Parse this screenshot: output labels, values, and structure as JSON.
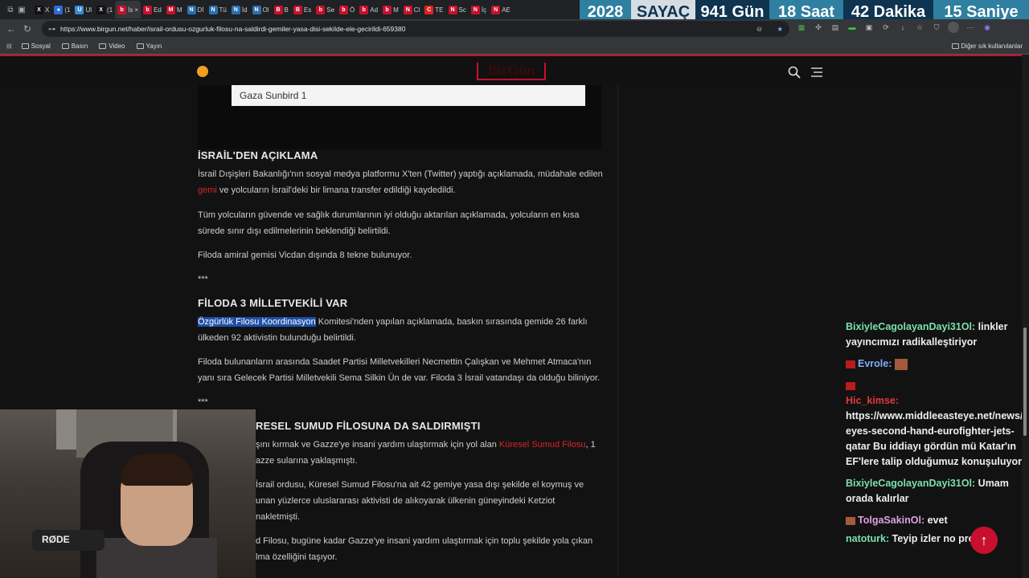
{
  "browser": {
    "tabs": [
      {
        "icon": "x-icon",
        "color": "#111111",
        "glyph": "X",
        "label": "X"
      },
      {
        "icon": "globe-icon",
        "color": "#2b6cd8",
        "glyph": "●",
        "label": "(1"
      },
      {
        "icon": "blue-icon",
        "color": "#3a8ad8",
        "glyph": "U",
        "label": "Ul"
      },
      {
        "icon": "x-icon",
        "color": "#111111",
        "glyph": "X",
        "label": "(1"
      },
      {
        "icon": "birgun-icon",
        "color": "#c8102e",
        "glyph": "b",
        "label": "İs",
        "active": true
      },
      {
        "icon": "birgun-icon",
        "color": "#c8102e",
        "glyph": "b",
        "label": "Ed"
      },
      {
        "icon": "mail-icon",
        "color": "#c8102e",
        "glyph": "M",
        "label": "M"
      },
      {
        "icon": "news-icon",
        "color": "#2a6fb0",
        "glyph": "N",
        "label": "Dİ"
      },
      {
        "icon": "news-icon",
        "color": "#2a6fb0",
        "glyph": "N",
        "label": "Tü"
      },
      {
        "icon": "news-icon",
        "color": "#2a6fb0",
        "glyph": "N",
        "label": "İd"
      },
      {
        "icon": "news-icon",
        "color": "#2a6fb0",
        "glyph": "N",
        "label": "Ol"
      },
      {
        "icon": "b-icon",
        "color": "#c8102e",
        "glyph": "B",
        "label": "B"
      },
      {
        "icon": "b-icon",
        "color": "#c8102e",
        "glyph": "B",
        "label": "Es"
      },
      {
        "icon": "birgun-icon",
        "color": "#c8102e",
        "glyph": "b",
        "label": "Se"
      },
      {
        "icon": "birgun-icon",
        "color": "#c8102e",
        "glyph": "b",
        "label": "Ö"
      },
      {
        "icon": "birgun-icon",
        "color": "#c8102e",
        "glyph": "b",
        "label": "Ad"
      },
      {
        "icon": "birgun-icon",
        "color": "#c8102e",
        "glyph": "b",
        "label": "M"
      },
      {
        "icon": "news-icon",
        "color": "#c8102e",
        "glyph": "N",
        "label": "Cl"
      },
      {
        "icon": "c-icon",
        "color": "#e02020",
        "glyph": "C",
        "label": "TE"
      },
      {
        "icon": "news-icon",
        "color": "#c8102e",
        "glyph": "N",
        "label": "Sc"
      },
      {
        "icon": "news-icon",
        "color": "#c8102e",
        "glyph": "N",
        "label": "İç"
      },
      {
        "icon": "news-icon",
        "color": "#c8102e",
        "glyph": "N",
        "label": "AE"
      }
    ],
    "url": "https://www.birgun.net/haber/israil-ordusu-ozgurluk-filosu-na-saldirdi-gemiler-yasa-disi-sekilde-ele-gecirildi-659380",
    "bookmarks": [
      "Sosyal",
      "Basın",
      "Video",
      "Yayın"
    ],
    "bookmarks_other": "Diğer sık kullanılanlar"
  },
  "countdown": {
    "year": "2028",
    "label": "SAYAÇ",
    "days": "941 Gün",
    "hours": "18 Saat",
    "minutes": "42 Dakika",
    "seconds": "15 Saniye"
  },
  "site": {
    "logo": "BirGün",
    "accent": "#c8102e"
  },
  "article": {
    "video_caption": "Gaza Sunbird 1",
    "section1_title": "İSRAİL'DEN AÇIKLAMA",
    "p1_a": "İsrail Dışişleri Bakanlığı'nın sosyal medya platformu X'ten (Twitter) yaptığı açıklamada, müdahale edilen ",
    "p1_link": "gemi",
    "p1_b": " ve yolcuların İsrail'deki bir limana transfer edildiği kaydedildi.",
    "p2": "Tüm yolcuların güvende ve sağlık durumlarının iyi olduğu aktarılan açıklamada, yolcuların en kısa sürede sınır dışı edilmelerinin beklendiği belirtildi.",
    "p3": "Filoda amiral gemisi Vicdan dışında 8 tekne bulunuyor.",
    "sep1": "***",
    "section2_title": "FİLODA 3 MİLLETVEKİLİ VAR",
    "p4_highlight": "Özgürlük Filosu Koordinasyon",
    "p4_rest": " Komitesi'nden yapılan açıklamada, baskın sırasında gemide 26 farklı ülkeden 92 aktivistin bulunduğu belirtildi.",
    "p5": "Filoda bulunanların arasında Saadet Partisi Milletvekilleri Necmettin Çalışkan ve Mehmet Atmaca'nın yanı sıra Gelecek Partisi Milletvekili Sema Silkin Ün de var. Filoda 3 İsrail vatandaşı da olduğu biliniyor.",
    "sep2": "***",
    "section3_title_partial": "RESEL SUMUD FİLOSUNA DA SALDIRMIŞTI",
    "p6_a": "şını kırmak ve Gazze'ye insani yardım ulaştırmak için yol alan ",
    "p6_link": "Küresel Sumud Filosu",
    "p6_b": ", 1",
    "p6_c": "azze sularına yaklaşmıştı.",
    "p7_a": " İsrail ordusu, Küresel Sumud Filosu'na ait 42 gemiye yasa dışı şekilde el koymuş ve",
    "p7_b": "unan yüzlerce uluslararası aktivisti de alıkoyarak ülkenin güneyindeki Ketziot",
    "p7_c": "nakletmişti.",
    "p8_a": "d Filosu, bugüne kadar Gazze'ye insani yardım ulaştırmak için toplu şekilde yola çıkan",
    "p8_b": "lma özelliğini taşıyor."
  },
  "chat": {
    "m1_user": "BixiyleCagolayanDayi31Ol:",
    "m1_text": " linkler yayıncımızı radikalleştiriyor",
    "m2_user": "Evrole:",
    "m3_user": "Hic_kimse:",
    "m3_text": " https://www.middleeasteye.net/news/turkey-eyes-second-hand-eurofighter-jets-qatar Bu iddiayı gördün mü Katar'ın EF'lere talip olduğumuz konuşuluyor",
    "m4_user": "BixiyleCagolayanDayi31Ol:",
    "m4_text": " Umam orada kalırlar",
    "m5_user": "TolgaSakinOl:",
    "m5_text": " evet",
    "m6_user": "natoturk:",
    "m6_text": " Teyip izler no probz"
  },
  "webcam": {
    "mic_label": "RØDE"
  }
}
